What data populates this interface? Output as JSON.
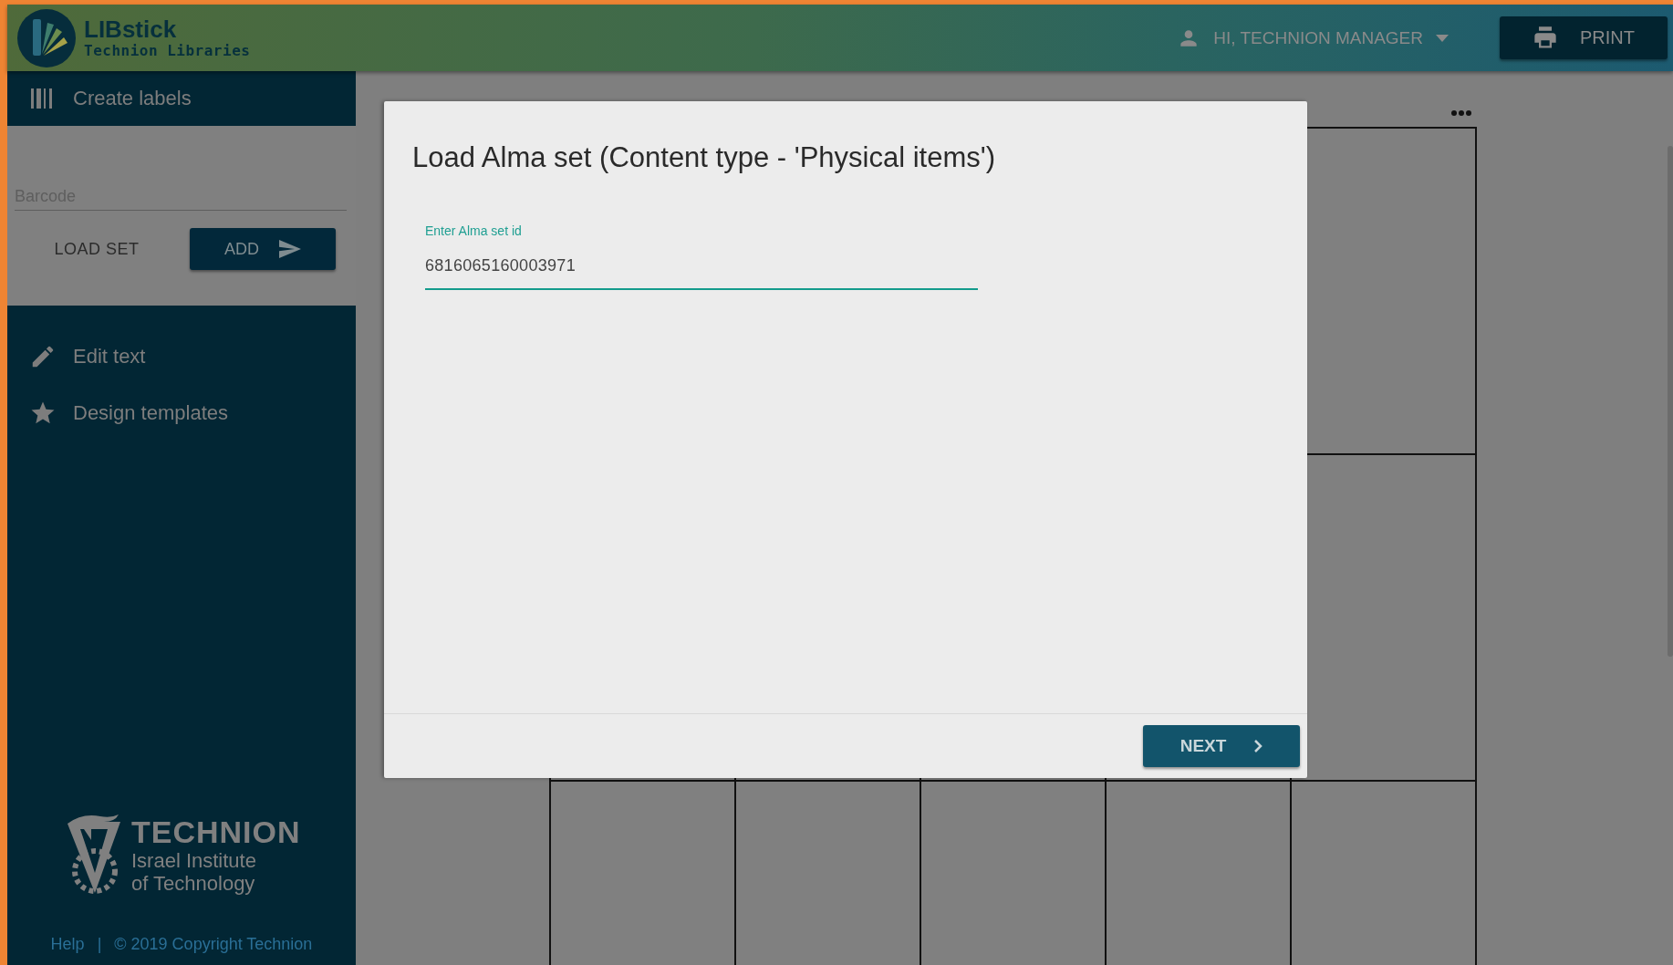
{
  "header": {
    "logo_title": "LIBstick",
    "logo_subtitle": "Technion Libraries",
    "user": "HI, TECHNION MANAGER",
    "print_button": "PRINT"
  },
  "sidebar": {
    "create_labels": "Create labels",
    "barcode": {
      "placeholder": "Barcode"
    },
    "load_set_button": "LOAD SET",
    "add_button": "ADD",
    "nav": [
      {
        "label": "Edit text",
        "kind": "pencil"
      },
      {
        "label": "Design templates",
        "kind": "star"
      }
    ],
    "footer_logo": {
      "name": "TECHNION",
      "line1": "Israel Institute",
      "line2": "of Technology"
    },
    "footer": {
      "help": "Help",
      "separator": "|",
      "copyright": "© 2019 Copyright Technion"
    }
  },
  "dialog": {
    "title": "Load Alma set (Content type - 'Physical items')",
    "field": {
      "label": "Enter Alma set id",
      "value": "6816065160003971"
    },
    "next_button": "NEXT"
  }
}
